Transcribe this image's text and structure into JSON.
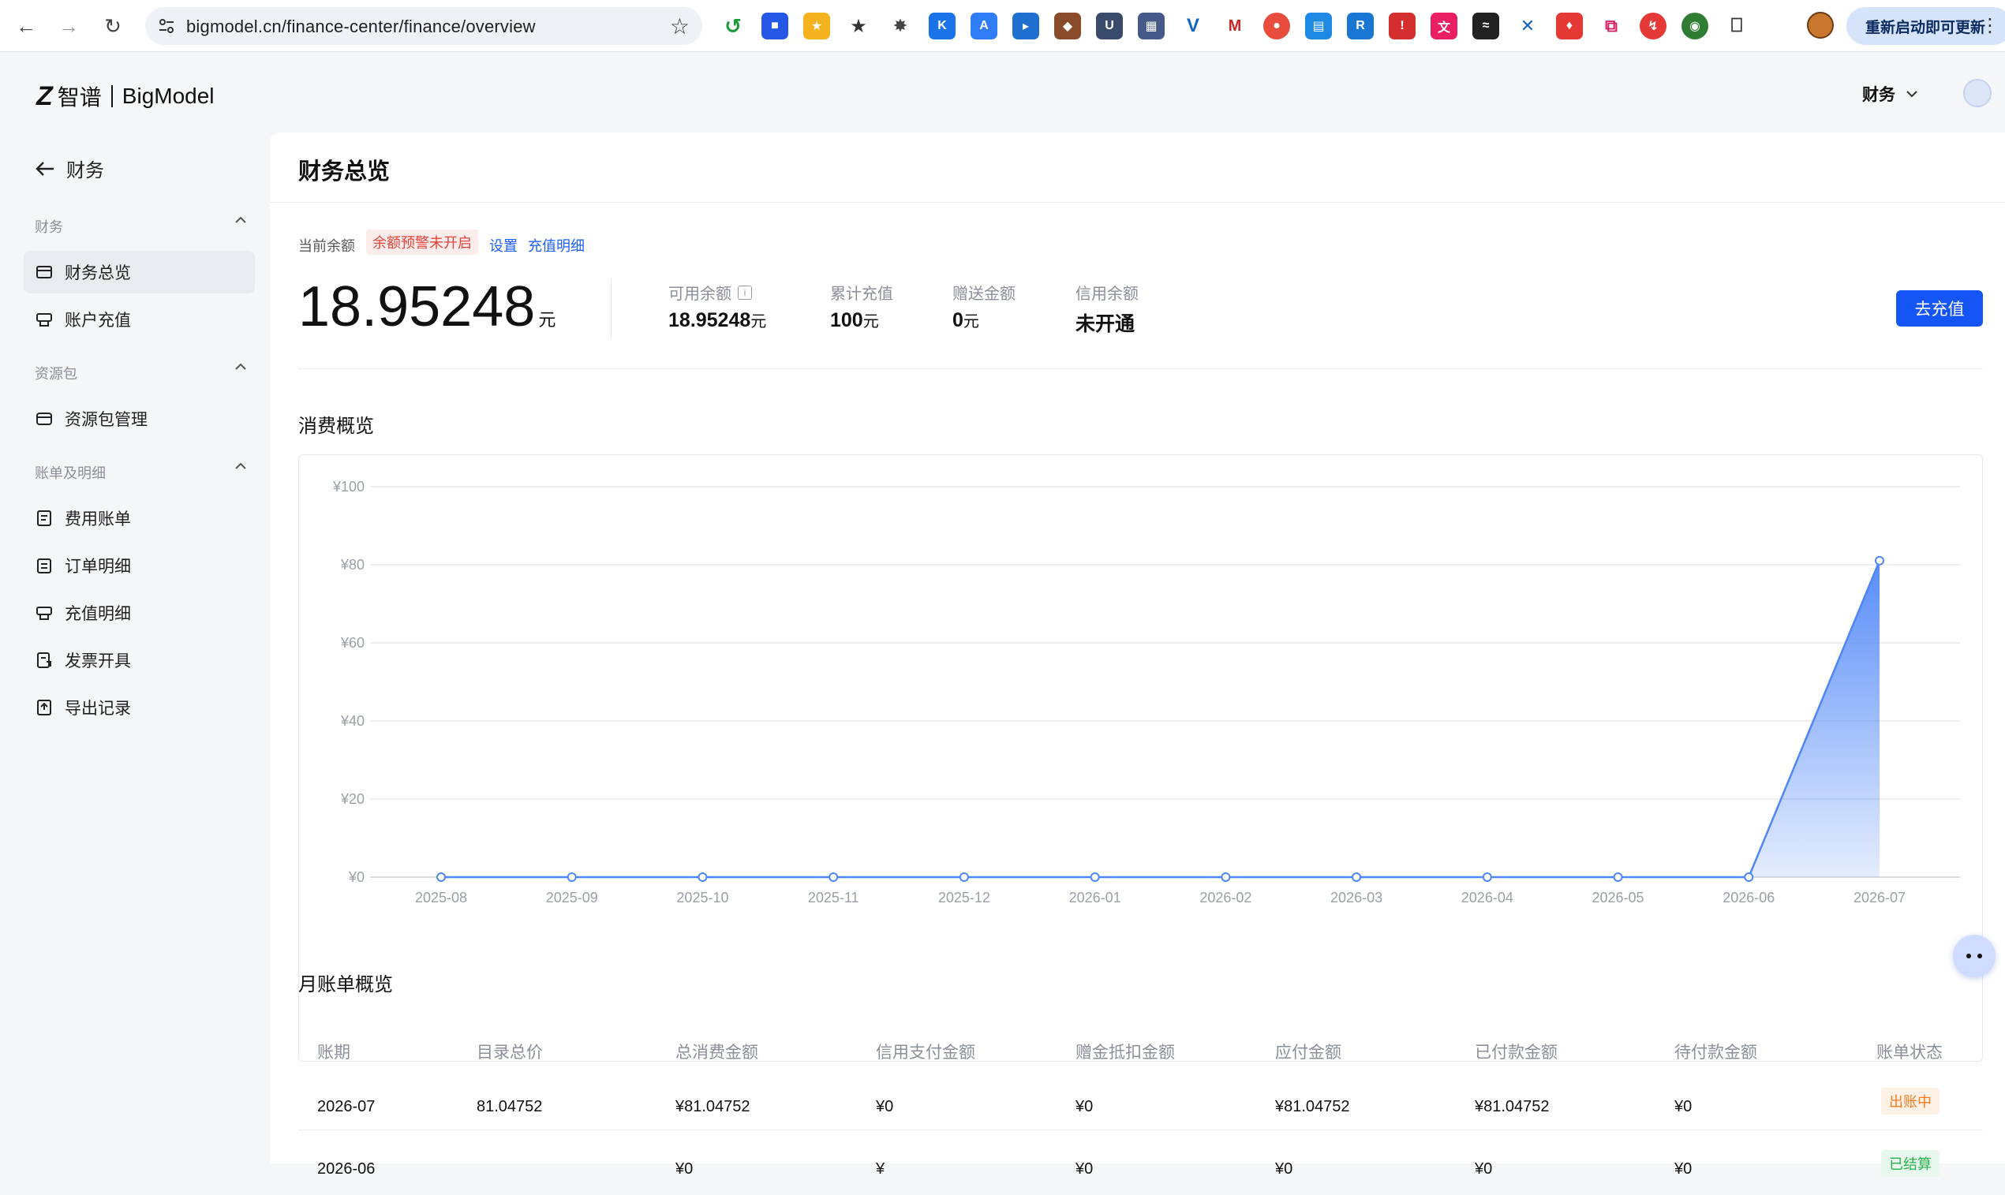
{
  "browser": {
    "url": "bigmodel.cn/finance-center/finance/overview",
    "restart_label": "重新启动即可更新"
  },
  "header": {
    "brand_cn": "智谱",
    "brand_en": "BigModel",
    "menu_label": "财务"
  },
  "sidebar": {
    "back_label": "财务",
    "groups": [
      {
        "label": "财务"
      },
      {
        "label": "资源包"
      },
      {
        "label": "账单及明细"
      }
    ],
    "items": [
      {
        "label": "财务总览",
        "icon": "wallet-icon"
      },
      {
        "label": "账户充值",
        "icon": "recharge-icon"
      },
      {
        "label": "资源包管理",
        "icon": "package-icon"
      },
      {
        "label": "费用账单",
        "icon": "bill-icon"
      },
      {
        "label": "订单明细",
        "icon": "order-icon"
      },
      {
        "label": "充值明细",
        "icon": "recharge-detail-icon"
      },
      {
        "label": "发票开具",
        "icon": "invoice-icon"
      },
      {
        "label": "导出记录",
        "icon": "export-icon"
      }
    ]
  },
  "page": {
    "title": "财务总览",
    "balance_label": "当前余额",
    "warn_tag": "余额预警未开启",
    "settings_link": "设置",
    "recharge_detail_link": "充值明细",
    "balance_value": "18.95248",
    "balance_unit": "元",
    "stats": [
      {
        "label": "可用余额",
        "value": "18.95248",
        "unit": "元"
      },
      {
        "label": "累计充值",
        "value": "100",
        "unit": "元"
      },
      {
        "label": "赠送金额",
        "value": "0",
        "unit": "元"
      },
      {
        "label": "信用余额",
        "value": "未开通",
        "unit": ""
      }
    ],
    "recharge_button": "去充值",
    "consumption_title": "消费概览",
    "monthly_title": "月账单概览"
  },
  "chart_data": {
    "type": "area",
    "x": [
      "2025-08",
      "2025-09",
      "2025-10",
      "2025-11",
      "2025-12",
      "2026-01",
      "2026-02",
      "2026-03",
      "2026-04",
      "2026-05",
      "2026-06",
      "2026-07"
    ],
    "y_tick_labels": [
      "¥100",
      "¥80",
      "¥60",
      "¥40",
      "¥20",
      "¥0"
    ],
    "series": [
      {
        "values": [
          0,
          0,
          0,
          0,
          0,
          0,
          0,
          0,
          0,
          0,
          0,
          81.04752
        ]
      }
    ],
    "ylim": [
      0,
      100
    ],
    "grid": true,
    "color": "#4f86f7"
  },
  "table": {
    "columns": [
      "账期",
      "目录总价",
      "总消费金额",
      "信用支付金额",
      "赠金抵扣金额",
      "应付金额",
      "已付款金额",
      "待付款金额",
      "账单状态"
    ],
    "rows": [
      {
        "cells": [
          "2026-07",
          "81.04752",
          "¥81.04752",
          "¥0",
          "¥0",
          "¥81.04752",
          "¥81.04752",
          "¥0"
        ],
        "status": "出账中",
        "status_color": "orange"
      },
      {
        "cells": [
          "2026-06",
          "",
          "¥0",
          "¥",
          "¥0",
          "¥0",
          "¥0",
          "¥0"
        ],
        "status": "已结算",
        "status_color": "green"
      }
    ]
  }
}
